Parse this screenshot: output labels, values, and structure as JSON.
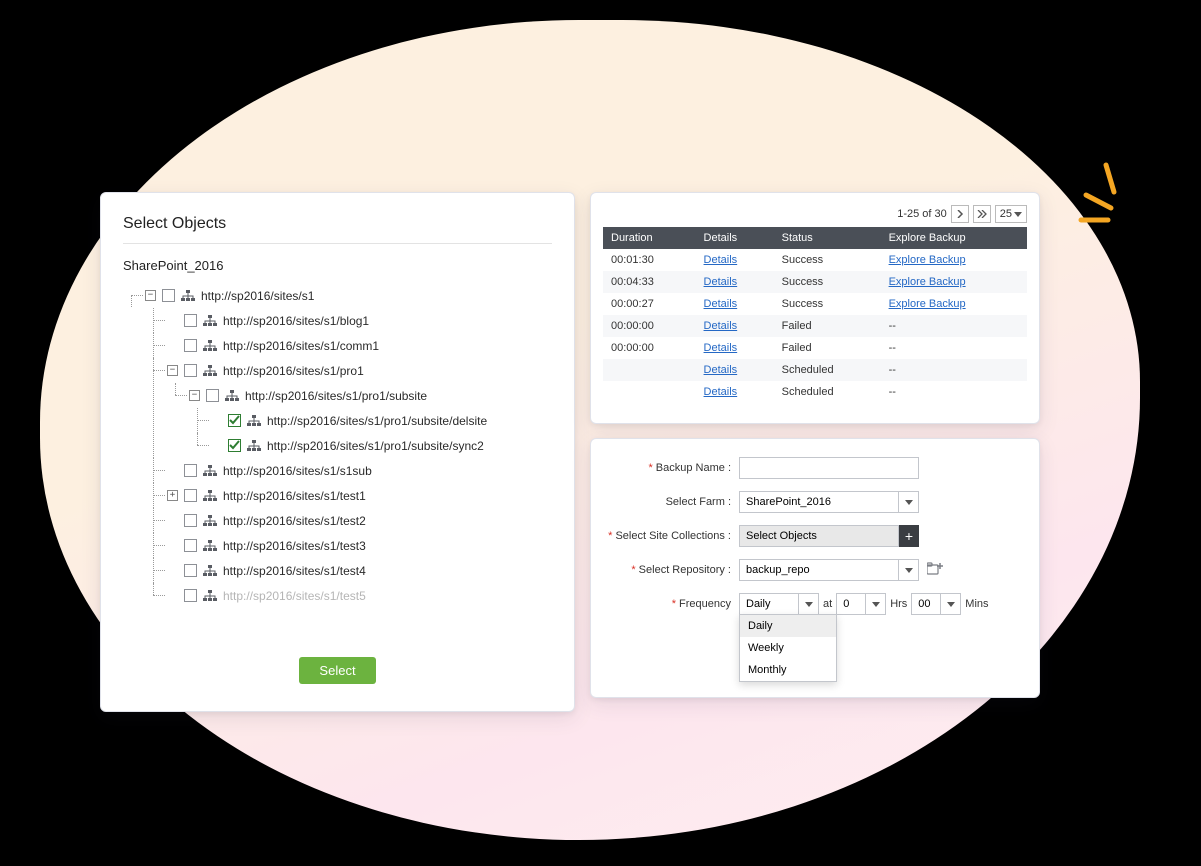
{
  "colors": {
    "accent": "#f4a623",
    "button": "#6cb33f",
    "link": "#2468c5",
    "header": "#4a4f57"
  },
  "tree_panel": {
    "title": "Select Objects",
    "farm": "SharePoint_2016",
    "select_button": "Select",
    "nodes": [
      {
        "label": "http://sp2016/sites/s1",
        "toggle": "minus",
        "checked": false,
        "children": [
          {
            "label": "http://sp2016/sites/s1/blog1",
            "checked": false
          },
          {
            "label": "http://sp2016/sites/s1/comm1",
            "checked": false
          },
          {
            "label": "http://sp2016/sites/s1/pro1",
            "toggle": "minus",
            "checked": false,
            "children": [
              {
                "label": "http://sp2016/sites/s1/pro1/subsite",
                "toggle": "minus",
                "checked": false,
                "children": [
                  {
                    "label": "http://sp2016/sites/s1/pro1/subsite/delsite",
                    "checked": true
                  },
                  {
                    "label": "http://sp2016/sites/s1/pro1/subsite/sync2",
                    "checked": true
                  }
                ]
              }
            ]
          },
          {
            "label": "http://sp2016/sites/s1/s1sub",
            "checked": false
          },
          {
            "label": "http://sp2016/sites/s1/test1",
            "toggle": "plus",
            "checked": false
          },
          {
            "label": "http://sp2016/sites/s1/test2",
            "checked": false
          },
          {
            "label": "http://sp2016/sites/s1/test3",
            "checked": false
          },
          {
            "label": "http://sp2016/sites/s1/test4",
            "checked": false
          },
          {
            "label": "http://sp2016/sites/s1/test5",
            "checked": false,
            "cut": true
          }
        ]
      }
    ]
  },
  "table_panel": {
    "pager": {
      "range": "1-25 of 30",
      "page_size": "25"
    },
    "columns": [
      "Duration",
      "Details",
      "Status",
      "Explore Backup"
    ],
    "details_link": "Details",
    "explore_link": "Explore Backup",
    "rows": [
      {
        "duration": "00:01:30",
        "status": "Success",
        "explore": true
      },
      {
        "duration": "00:04:33",
        "status": "Success",
        "explore": true
      },
      {
        "duration": "00:00:27",
        "status": "Success",
        "explore": true
      },
      {
        "duration": "00:00:00",
        "status": "Failed",
        "explore": false
      },
      {
        "duration": "00:00:00",
        "status": "Failed",
        "explore": false
      },
      {
        "duration": "",
        "status": "Scheduled",
        "explore": false
      },
      {
        "duration": "",
        "status": "Scheduled",
        "explore": false
      }
    ]
  },
  "form_panel": {
    "labels": {
      "backup_name": "Backup Name :",
      "select_farm": "Select Farm :",
      "select_site_collections": "Select Site Collections :",
      "select_repository": "Select Repository :",
      "frequency": "Frequency",
      "at": "at",
      "hrs": "Hrs",
      "mins": "Mins"
    },
    "values": {
      "backup_name": "",
      "select_farm": "SharePoint_2016",
      "select_objects_text": "Select Objects",
      "select_repository": "backup_repo",
      "frequency": "Daily",
      "hour": "0",
      "min": "00"
    },
    "frequency_options": [
      "Daily",
      "Weekly",
      "Monthly"
    ]
  }
}
